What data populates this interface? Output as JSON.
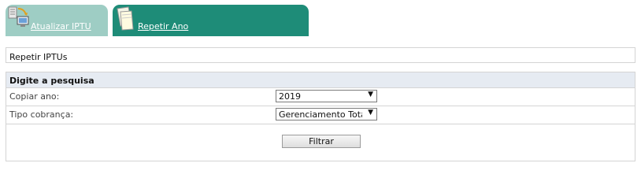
{
  "tabs": [
    {
      "label": "Atualizar IPTU",
      "active": false
    },
    {
      "label": "Repetir Ano",
      "active": true
    }
  ],
  "panel": {
    "title": "Repetir IPTUs"
  },
  "search": {
    "header": "Digite a pesquisa",
    "fields": [
      {
        "label": "Copiar ano:",
        "value": "2019"
      },
      {
        "label": "Tipo cobrança:",
        "value": "Gerenciamento Total"
      }
    ],
    "button": "Filtrar"
  },
  "colors": {
    "tab_active": "#1e8c78",
    "tab_inactive": "#9ecdc4",
    "header_bg": "#e6ebf2"
  },
  "icons": {
    "tab1": "computer-sync-icon",
    "tab2": "documents-icon"
  }
}
